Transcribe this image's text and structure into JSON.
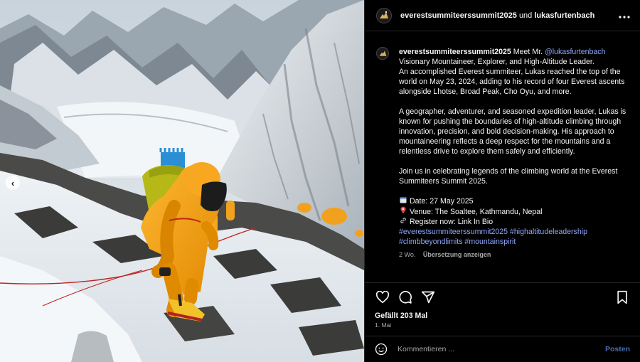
{
  "post": {
    "author": "everestsummiteerssummit2025",
    "collab_connector": "und",
    "collaborator": "lukasfurtenbach",
    "more_icon": "more-horizontal-icon",
    "caption": {
      "username": "everestsummiteerssummit2025",
      "intro": "Meet Mr.",
      "mention": "@lukasfurtenbach",
      "line1": "Visionary Mountaineer, Explorer, and High-Altitude Leader.",
      "para1": "An accomplished Everest summiteer, Lukas reached the top of the world on May 23, 2024, adding to his record of four Everest ascents alongside Lhotse, Broad Peak, Cho Oyu, and more.",
      "para2": "A geographer, adventurer, and seasoned expedition leader, Lukas is known for pushing the boundaries of high-altitude climbing through innovation, precision, and bold decision-making. His approach to mountaineering reflects a deep respect for the mountains and a relentless drive to explore them safely and efficiently.",
      "para3": "Join us in celebrating legends of the climbing world at the Everest Summiteers Summit 2025.",
      "date_line": "Date: 27 May 2025",
      "venue_line": "Venue: The Soaltee, Kathmandu, Nepal",
      "register_line": "Register now: Link In Bio",
      "hashtags": "#everestsummiteerssummit2025 #highaltitudeleadership #climbbeyondlimits #mountainspirit"
    },
    "caption_age": "2 Wo.",
    "translate_label": "Übersetzung anzeigen",
    "likes": "Gefällt 203 Mal",
    "posted_date": "1. Mai",
    "comment_placeholder": "Kommentieren ...",
    "post_button": "Posten",
    "nav_prev_glyph": "‹",
    "colors": {
      "background": "#000000",
      "link": "#8ea6f9",
      "post_button": "#4c6dad",
      "muted": "#a8a8a8"
    }
  }
}
